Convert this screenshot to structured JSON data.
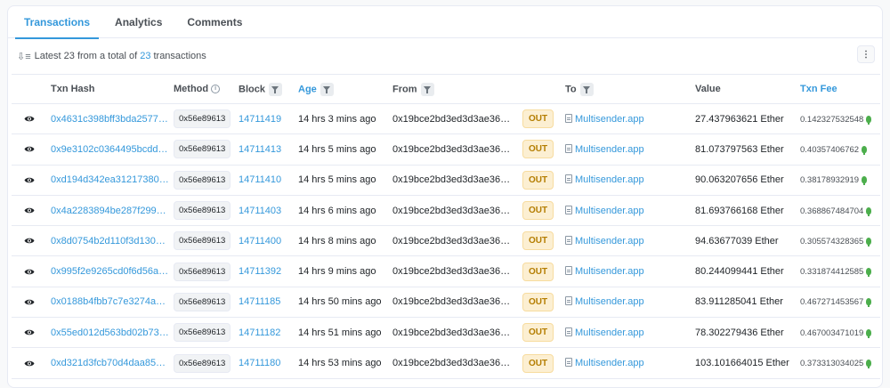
{
  "tabs": [
    {
      "label": "Transactions",
      "active": true
    },
    {
      "label": "Analytics",
      "active": false
    },
    {
      "label": "Comments",
      "active": false
    }
  ],
  "summary": {
    "prefix": "Latest 23 from a total of",
    "count": "23",
    "suffix": "transactions"
  },
  "more_button": "⋮",
  "columns": {
    "txn_hash": "Txn Hash",
    "method": "Method",
    "block": "Block",
    "age": "Age",
    "from": "From",
    "to": "To",
    "value": "Value",
    "txn_fee": "Txn Fee"
  },
  "direction_label": "OUT",
  "rows": [
    {
      "hash": "0x4631c398bff3bda2577…",
      "method": "0x56e89613",
      "block": "14711419",
      "age": "14 hrs 3 mins ago",
      "from": "0x19bce2bd3ed3d3ae36…",
      "to": "Multisender.app",
      "value": "27.437963621 Ether",
      "fee": "0.142327532548"
    },
    {
      "hash": "0x9e3102c0364495bcdd…",
      "method": "0x56e89613",
      "block": "14711413",
      "age": "14 hrs 5 mins ago",
      "from": "0x19bce2bd3ed3d3ae36…",
      "to": "Multisender.app",
      "value": "81.073797563 Ether",
      "fee": "0.40357406762"
    },
    {
      "hash": "0xd194d342ea31217380…",
      "method": "0x56e89613",
      "block": "14711410",
      "age": "14 hrs 5 mins ago",
      "from": "0x19bce2bd3ed3d3ae36…",
      "to": "Multisender.app",
      "value": "90.063207656 Ether",
      "fee": "0.38178932919"
    },
    {
      "hash": "0x4a2283894be287f299…",
      "method": "0x56e89613",
      "block": "14711403",
      "age": "14 hrs 6 mins ago",
      "from": "0x19bce2bd3ed3d3ae36…",
      "to": "Multisender.app",
      "value": "81.693766168 Ether",
      "fee": "0.368867484704"
    },
    {
      "hash": "0x8d0754b2d110f3d130…",
      "method": "0x56e89613",
      "block": "14711400",
      "age": "14 hrs 8 mins ago",
      "from": "0x19bce2bd3ed3d3ae36…",
      "to": "Multisender.app",
      "value": "94.63677039 Ether",
      "fee": "0.305574328365"
    },
    {
      "hash": "0x995f2e9265cd0f6d56a…",
      "method": "0x56e89613",
      "block": "14711392",
      "age": "14 hrs 9 mins ago",
      "from": "0x19bce2bd3ed3d3ae36…",
      "to": "Multisender.app",
      "value": "80.244099441 Ether",
      "fee": "0.331874412585"
    },
    {
      "hash": "0x0188b4fbb7c7e3274a…",
      "method": "0x56e89613",
      "block": "14711185",
      "age": "14 hrs 50 mins ago",
      "from": "0x19bce2bd3ed3d3ae36…",
      "to": "Multisender.app",
      "value": "83.911285041 Ether",
      "fee": "0.467271453567"
    },
    {
      "hash": "0x55ed012d563bd02b73…",
      "method": "0x56e89613",
      "block": "14711182",
      "age": "14 hrs 51 mins ago",
      "from": "0x19bce2bd3ed3d3ae36…",
      "to": "Multisender.app",
      "value": "78.302279436 Ether",
      "fee": "0.467003471019"
    },
    {
      "hash": "0xd321d3fcb70d4daa85…",
      "method": "0x56e89613",
      "block": "14711180",
      "age": "14 hrs 53 mins ago",
      "from": "0x19bce2bd3ed3d3ae36…",
      "to": "Multisender.app",
      "value": "103.101664015 Ether",
      "fee": "0.373313034025"
    }
  ],
  "colors": {
    "link": "#3498db",
    "out_badge_bg": "#fcefd2",
    "out_badge_text": "#b47d00",
    "gas_icon": "#4cae4c"
  }
}
